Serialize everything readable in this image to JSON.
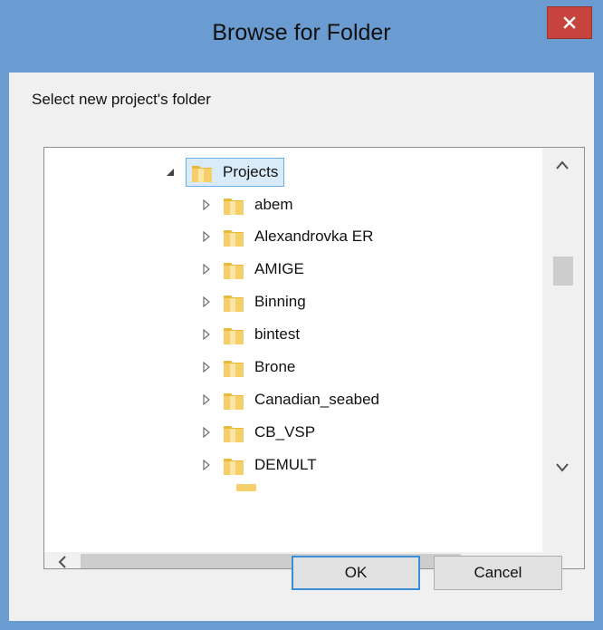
{
  "window": {
    "title": "Browse for Folder"
  },
  "dialog": {
    "prompt": "Select new project's folder",
    "tree": {
      "root": {
        "label": "Projects",
        "expanded": true,
        "selected": true
      },
      "children": [
        {
          "label": "abem"
        },
        {
          "label": "Alexandrovka ER"
        },
        {
          "label": "AMIGE"
        },
        {
          "label": "Binning"
        },
        {
          "label": "bintest"
        },
        {
          "label": "Brone"
        },
        {
          "label": "Canadian_seabed"
        },
        {
          "label": "CB_VSP"
        },
        {
          "label": "DEMULT"
        }
      ]
    },
    "buttons": {
      "ok": "OK",
      "cancel": "Cancel"
    }
  },
  "colors": {
    "title_bar": "#6a9bd1",
    "close_button": "#c7433d",
    "selection_border": "#6aafe8",
    "folder": "#f5c84c"
  }
}
